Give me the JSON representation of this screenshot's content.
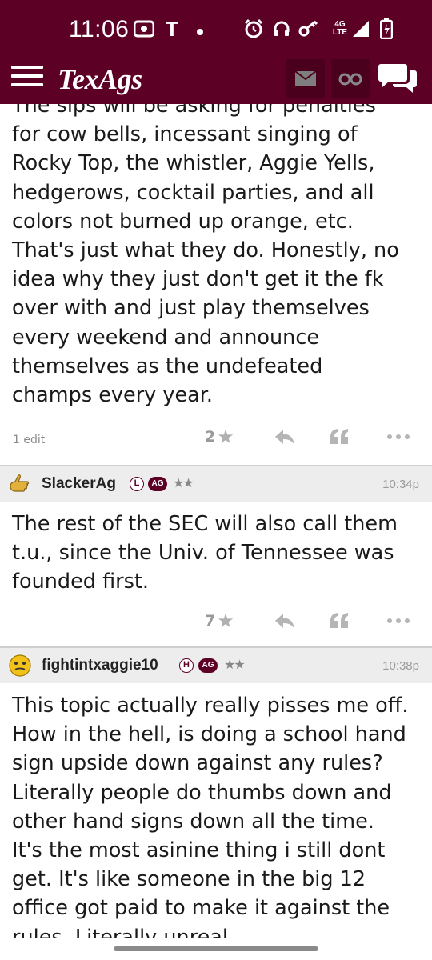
{
  "status_bar": {
    "time": "11:06",
    "carrier_icon": "T",
    "network": [
      "4G",
      "LTE"
    ],
    "icons": [
      "radio-icon",
      "t-mobile-icon",
      "dot-icon",
      "alarm-icon",
      "headphones-icon",
      "key-icon",
      "signal-icon",
      "battery-charging-icon"
    ]
  },
  "app_bar": {
    "logo": "TexAgs",
    "icons": [
      "menu-icon",
      "mail-icon",
      "binoculars-icon",
      "chat-icon"
    ]
  },
  "colors": {
    "brand": "#5d0025",
    "header_bg": "#ededed",
    "muted": "#9a9a9a"
  },
  "posts": [
    {
      "partial_top_line": "The sips will be asking for penalties",
      "lines": [
        "for cow bells, incessant singing of",
        "Rocky Top, the whistler, Aggie Yells,",
        "hedgerows, cocktail parties, and all",
        "colors not burned up orange, etc.",
        "That's just what they do. Honestly, no",
        "idea why they just don't get it the fk",
        "over with and just play themselves",
        "every weekend and announce",
        "themselves as the undefeated",
        "champs every year."
      ],
      "edit_note": "1 edit",
      "stars": "2"
    },
    {
      "username": "SlackerAg",
      "level_badge": "L",
      "ag_badge": "AG",
      "rank": "★★",
      "time": "10:34p",
      "lines": [
        "The rest of the SEC will also call them",
        "t.u., since the Univ. of Tennessee was",
        "founded first."
      ],
      "stars": "7"
    },
    {
      "username": "fightintxaggie10",
      "level_badge": "H",
      "ag_badge": "AG",
      "rank": "★★",
      "time": "10:38p",
      "lines": [
        "This topic actually really pisses me off.",
        "How in the hell, is doing a school hand",
        "sign upside down against any rules?",
        "Literally people do thumbs down and",
        "other hand signs down all the time.",
        "It's the most asinine thing i still dont",
        "get. It's like someone in the big 12",
        "office got paid to make it against the",
        "rules. Literally unreal."
      ]
    }
  ]
}
